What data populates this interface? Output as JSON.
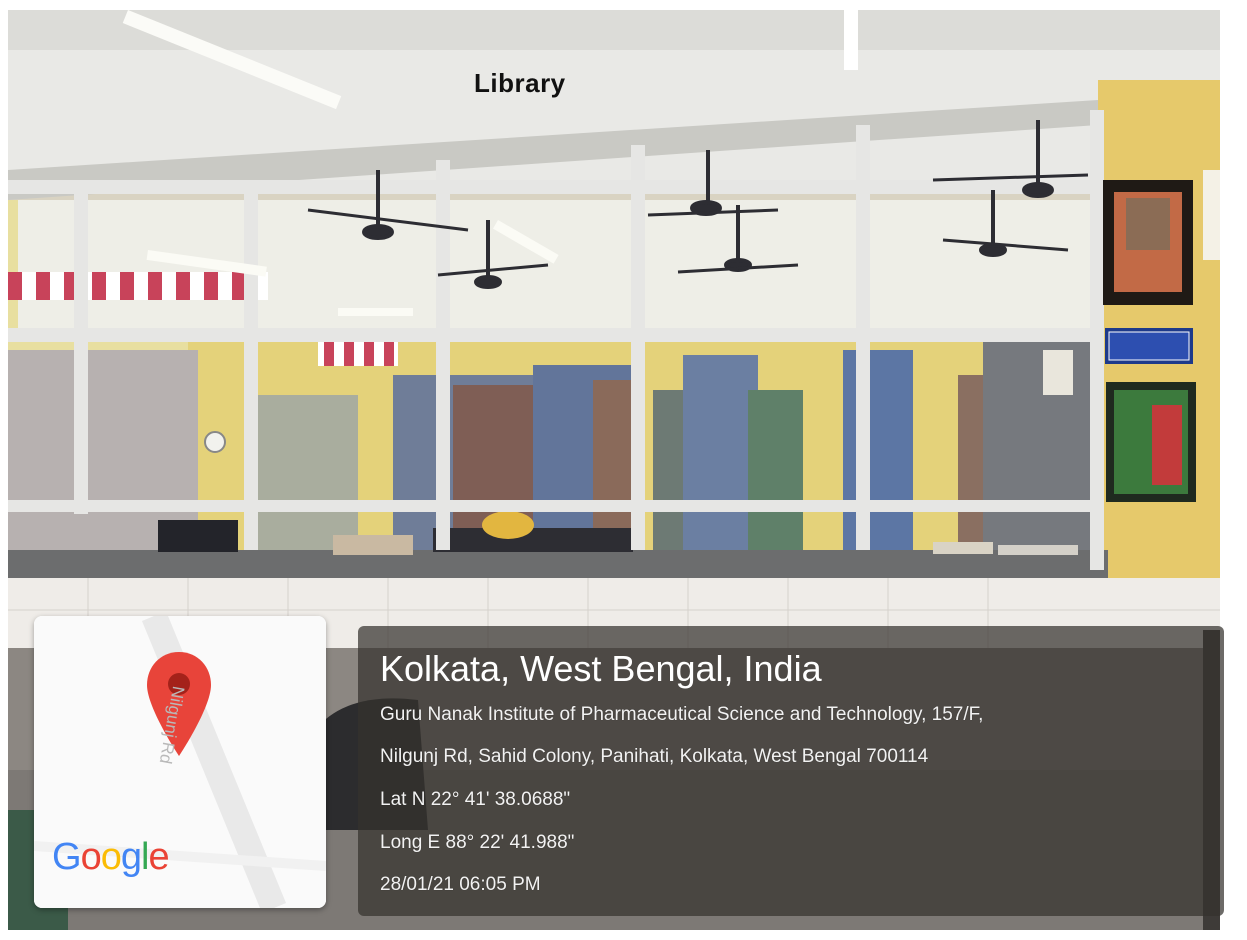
{
  "photo": {
    "sign_text": "Library",
    "description_icon": "library-photo"
  },
  "map_card": {
    "road_label": "Nilgunj Rd",
    "logo": [
      "G",
      "o",
      "o",
      "g",
      "l",
      "e"
    ],
    "logo_colors": [
      "#4285F4",
      "#EA4335",
      "#FBBC05",
      "#4285F4",
      "#34A853",
      "#EA4335"
    ],
    "pin_color": "#e8443a",
    "pin_icon": "map-pin-icon"
  },
  "geo_card": {
    "place": "Kolkata, West Bengal, India",
    "address_line1": "Guru Nanak Institute of Pharmaceutical Science and Technology, 157/F,",
    "address_line2": "Nilgunj Rd, Sahid Colony, Panihati, Kolkata, West Bengal 700114",
    "latitude": "Lat N 22° 41' 38.0688\"",
    "longitude": "Long E 88° 22' 41.988\"",
    "timestamp": "28/01/21 06:05 PM"
  }
}
